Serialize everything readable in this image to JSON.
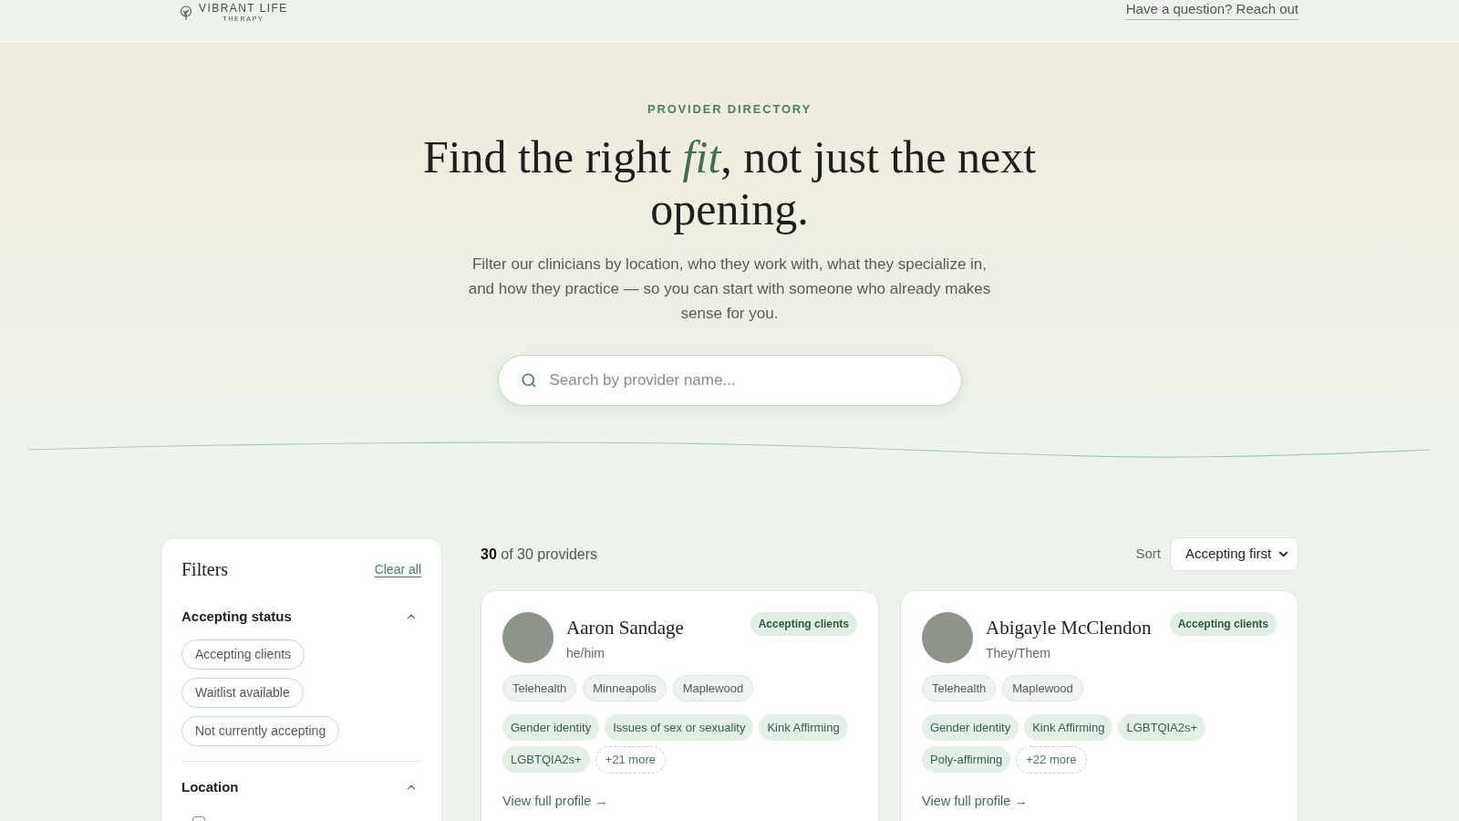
{
  "header": {
    "logo_text": "VIBRANT LIFE",
    "logo_subtext": "THERAPY",
    "contact_link": "Have a question? Reach out"
  },
  "hero": {
    "eyebrow": "PROVIDER DIRECTORY",
    "heading": "Find the right *fit*, not just the next opening.",
    "description": "Filter our clinicians by location, who they work with, what they specialize in, and how they practice — so you can start with someone who already makes sense for you.",
    "search": {
      "placeholder": "Search by provider name..."
    }
  },
  "filters": {
    "title": "Filters",
    "clear_label": "Clear all",
    "sections": [
      {
        "title": "Accepting status",
        "kind": "pills",
        "expanded": true,
        "options": [
          {
            "label": "Accepting clients",
            "selected": false
          },
          {
            "label": "Waitlist available",
            "selected": false
          },
          {
            "label": "Not currently accepting",
            "selected": false
          }
        ]
      },
      {
        "title": "Location",
        "kind": "checkboxes",
        "expanded": true,
        "options": [
          {
            "checked": false
          }
        ]
      }
    ]
  },
  "results": {
    "count": "**30** of 30 providers",
    "sort": {
      "label": "Sort",
      "value": "Accepting first"
    }
  },
  "providers": [
    {
      "name": "Aaron Sandage",
      "pronouns": "he/him",
      "status": {
        "kind": "accepting",
        "label": "Accepting clients"
      },
      "locations": [
        "Telehealth",
        "Minneapolis",
        "Maplewood"
      ],
      "specialties": [
        "Gender identity",
        "Issues of sex or sexuality",
        "Kink Affirming",
        "LGBTQIA2s+"
      ],
      "more": "+21 more",
      "link": "View full profile →"
    },
    {
      "name": "Abigayle McClendon",
      "pronouns": "They/Them",
      "status": {
        "kind": "accepting",
        "label": "Accepting clients"
      },
      "locations": [
        "Telehealth",
        "Maplewood"
      ],
      "specialties": [
        "Gender identity",
        "Kink Affirming",
        "LGBTQIA2s+",
        "Poly-affirming"
      ],
      "more": "+22 more",
      "link": "View full profile →"
    }
  ]
}
